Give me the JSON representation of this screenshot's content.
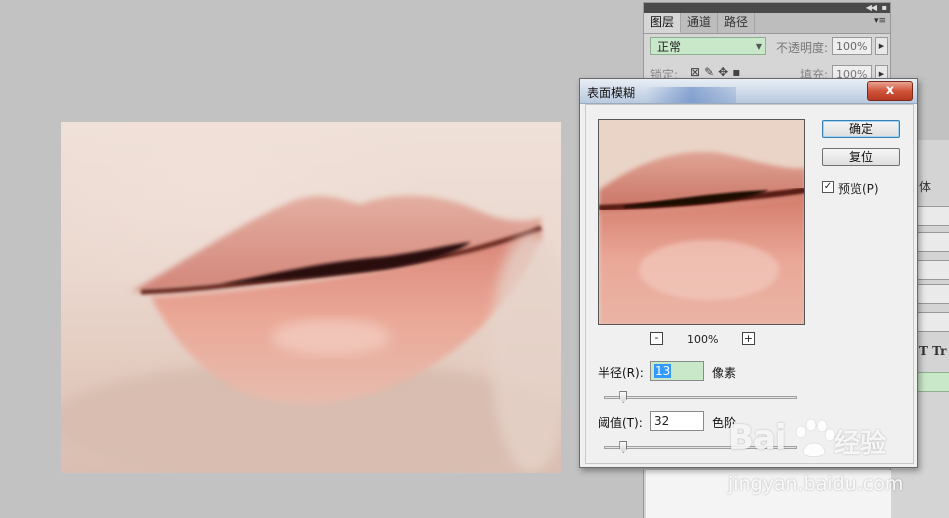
{
  "layers_panel": {
    "tabs": [
      {
        "label": "图层",
        "active": true
      },
      {
        "label": "通道",
        "active": false
      },
      {
        "label": "路径",
        "active": false
      }
    ],
    "blend_mode": "正常",
    "opacity_label": "不透明度:",
    "opacity_value": "100%",
    "lock_label": "锁定:",
    "fill_label": "填充:",
    "fill_value": "100%"
  },
  "side_panel": {
    "text_1": "体",
    "text_2": "T Tr"
  },
  "dialog": {
    "title": "表面模糊",
    "close_glyph": "x",
    "ok_label": "确定",
    "reset_label": "复位",
    "preview_checked": true,
    "preview_label": "预览(P)",
    "zoom_level": "100%",
    "zoom_out_glyph": "-",
    "zoom_in_glyph": "+",
    "radius": {
      "label": "半径(R):",
      "value": "13",
      "unit": "像素",
      "slider_fraction": 0.1
    },
    "threshold": {
      "label": "阈值(T):",
      "value": "32",
      "unit": "色阶",
      "slider_fraction": 0.1
    }
  },
  "watermark": {
    "logo_text": "Bai",
    "logo_suffix": "经验",
    "url": "jingyan.baidu.com"
  },
  "colors": {
    "app_background": "#c2c2c2",
    "accent_green": "#c9e8c9",
    "close_red": "#c94a30",
    "selection_blue": "#3399ff"
  }
}
